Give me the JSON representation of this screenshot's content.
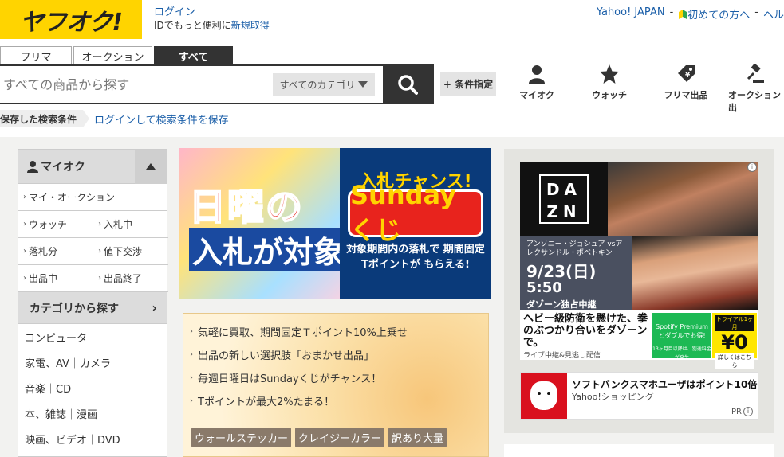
{
  "header": {
    "logo": "ヤフオク!",
    "login_link": "ログイン",
    "login_sub": "IDでもっと便利に",
    "register_link": "新規取得",
    "nav": [
      "Yahoo! JAPAN",
      "初めての方へ",
      "ヘル"
    ],
    "nav_sep": "-"
  },
  "tabs": [
    "フリマ",
    "オークション",
    "すべて"
  ],
  "search": {
    "placeholder": "すべての商品から探す",
    "category": "すべてのカテゴリ",
    "condition_button": "+ 条件指定"
  },
  "quick_links": [
    {
      "label": "マイオク",
      "icon": "user-icon"
    },
    {
      "label": "ウォッチ",
      "icon": "star-icon"
    },
    {
      "label": "フリマ出品",
      "icon": "price-tag-icon"
    },
    {
      "label": "オークション出",
      "icon": "gavel-icon"
    }
  ],
  "saved_search": {
    "label": "保存した検索条件",
    "link": "ログインして検索条件を保存"
  },
  "sidebar": {
    "title": "マイオク",
    "my_auction": "マイ・オークション",
    "grid": [
      "ウォッチ",
      "入札中",
      "落札分",
      "値下交渉",
      "出品中",
      "出品終了"
    ],
    "category_title": "カテゴリから探す",
    "categories": [
      "コンピュータ",
      "家電、AV｜カメラ",
      "音楽｜CD",
      "本、雑誌｜漫画",
      "映画、ビデオ｜DVD"
    ]
  },
  "banner": {
    "line1": "日曜の",
    "line2": "入札が対象",
    "logo_top_a": "入札",
    "logo_top_b": "チャンス!",
    "logo_main": "Sundayくじ",
    "sub": "対象期間内の落札で 期間固定Tポイントが もらえる!"
  },
  "notices": {
    "items": [
      "気軽に買取、期間固定Ｔポイント10%上乗せ",
      "出品の新しい選択肢「おまかせ出品」",
      "毎週日曜日はSundayくじがチャンス！",
      "Tポイントが最大2%たまる！"
    ],
    "tags": [
      "ウォールステッカー",
      "クレイジーカラー",
      "訳あり大量"
    ]
  },
  "ad_dazn": {
    "logo_top": "DA",
    "logo_bottom": "ZN",
    "fighters": "アンソニー・ジョシュア vsアレクサンドル・ポベトキン",
    "date": "9/23(日)",
    "time": "5:50",
    "exclusive": "ダゾーン独占中継",
    "headline": "ヘビー級防衛を懸けた、拳のぶつかり合いをダゾーンで。",
    "small": "ライブ中継&見逃し配信",
    "spotify": "Spotify Premium とダブルでお得!",
    "spotify_small": "13ヶ月目以降は、別途料金が発生",
    "trial": "トライアル1ヶ月",
    "price": "¥0",
    "more": "詳しくはこちら"
  },
  "ad_sb": {
    "title": "ソフトバンクスマホユーザはポイント10倍",
    "shop": "Yahoo!ショッピング",
    "pr": "PR"
  }
}
